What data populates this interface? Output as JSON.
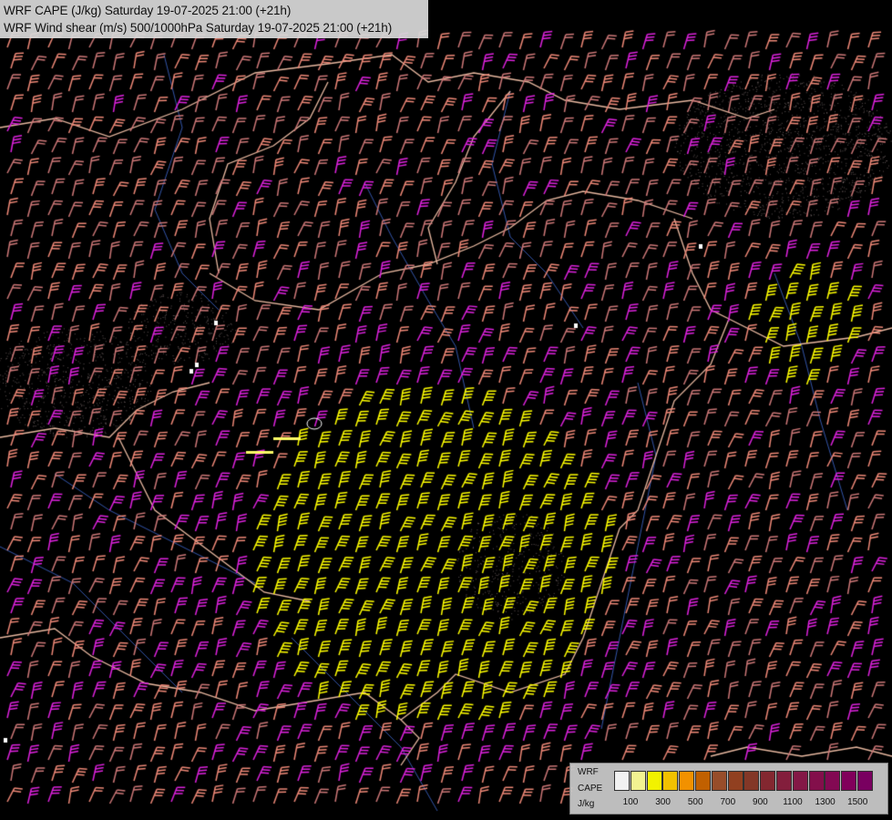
{
  "header": {
    "line1": "WRF CAPE (J/kg) Saturday 19-07-2025 21:00 (+21h)",
    "line2": "WRF Wind shear (m/s) 500/1000hPa Saturday 19-07-2025 21:00 (+21h)"
  },
  "legend": {
    "title_lines": [
      "WRF",
      "CAPE",
      "J/kg"
    ],
    "colors": [
      "#ffffff",
      "#ffff99",
      "#ffff00",
      "#ffcc00",
      "#ff9900",
      "#cc6600",
      "#a0522d",
      "#994422",
      "#8b3a2a",
      "#8b2a33",
      "#8b2040",
      "#8b1a4a",
      "#8b1050",
      "#8b0a58",
      "#880060",
      "#800066"
    ],
    "tick_labels": [
      "100",
      "300",
      "500",
      "700",
      "900",
      "1100",
      "1300",
      "1500"
    ]
  },
  "map": {
    "background": "#000000",
    "barb_colors": {
      "weak": "#cc7777",
      "moderate": "#ee8877",
      "strong": "#dd22dd",
      "very_strong": "#ffff00"
    },
    "border_color": "#e8b8a0",
    "river_color": "#3355aa"
  }
}
